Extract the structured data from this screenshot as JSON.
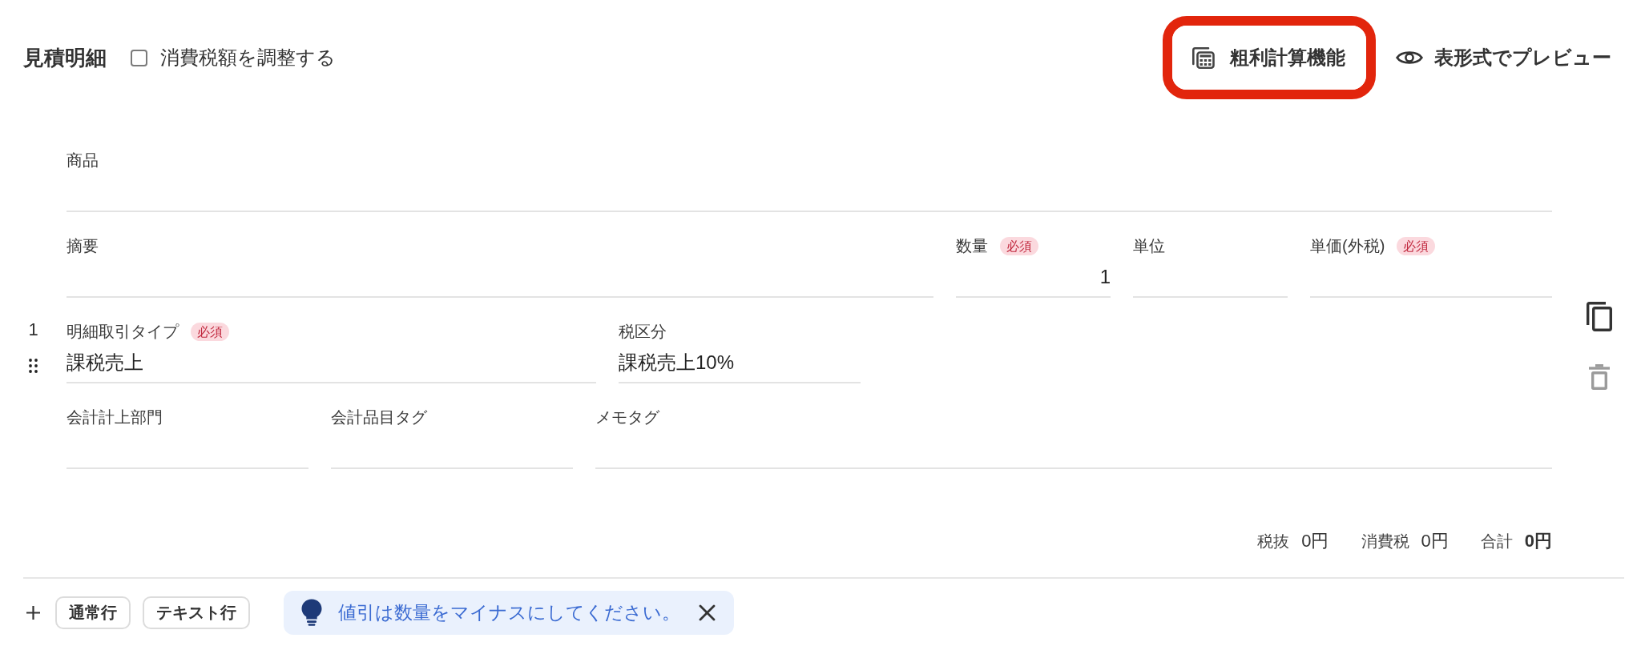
{
  "header": {
    "title": "見積明細",
    "tax_adjustment": {
      "label": "消費税額を調整する",
      "checked": false
    },
    "actions": [
      {
        "label": "粗利計算機能",
        "highlighted": true
      },
      {
        "label": "表形式でプレビュー",
        "highlighted": false
      }
    ]
  },
  "line_items": [
    {
      "number": "1",
      "rows": [
        [
          {
            "label": "商品",
            "kind": "text"
          }
        ],
        [
          {
            "label": "摘要",
            "kind": "text"
          },
          {
            "label": "数量",
            "badge": "必須",
            "kind": "number",
            "value": "1"
          },
          {
            "label": "単位",
            "kind": "text"
          },
          {
            "label": "単価(外税)",
            "badge": "必須",
            "kind": "number"
          }
        ],
        [
          {
            "label": "明細取引タイプ",
            "badge": "必須",
            "kind": "text",
            "value": "課税売上"
          },
          {
            "label": "税区分",
            "kind": "text",
            "value": "課税売上10%"
          }
        ],
        [
          {
            "label": "会計計上部門",
            "kind": "text"
          },
          {
            "label": "会計品目タグ",
            "kind": "text"
          },
          {
            "label": "メモタグ",
            "kind": "text"
          }
        ]
      ],
      "actions": {
        "copy": {
          "disabled": false
        },
        "delete": {
          "disabled": true
        }
      }
    }
  ],
  "totals": [
    {
      "label": "税抜",
      "value": "0円",
      "emphasized": false
    },
    {
      "label": "消費税",
      "value": "0円",
      "emphasized": false
    },
    {
      "label": "合計",
      "value": "0円",
      "emphasized": true
    }
  ],
  "footer": {
    "add_buttons": [
      {
        "label": "通常行"
      },
      {
        "label": "テキスト行"
      }
    ],
    "tip": {
      "text": "値引は数量をマイナスにしてください。"
    }
  }
}
